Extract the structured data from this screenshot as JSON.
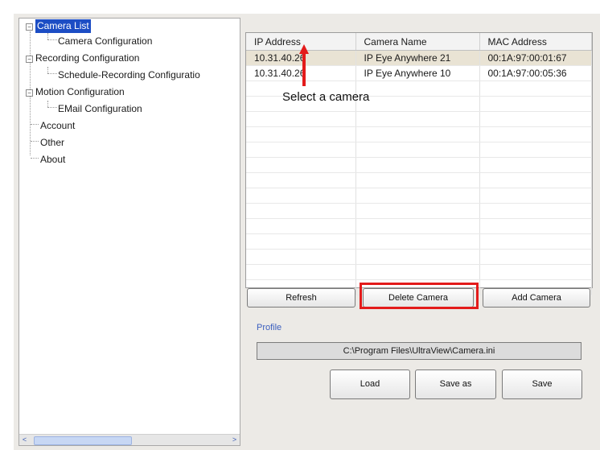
{
  "tree": {
    "items": [
      {
        "label": "Camera List",
        "selected": true
      },
      {
        "label": "Camera Configuration"
      },
      {
        "label": "Recording Configuration"
      },
      {
        "label": "Schedule-Recording Configuratio"
      },
      {
        "label": "Motion Configuration"
      },
      {
        "label": "EMail Configuration"
      },
      {
        "label": "Account"
      },
      {
        "label": "Other"
      },
      {
        "label": "About"
      }
    ],
    "expander_symbol": "−",
    "scroll_left": "<",
    "scroll_right": ">"
  },
  "camera_table": {
    "columns": [
      "IP Address",
      "Camera Name",
      "MAC Address"
    ],
    "rows": [
      [
        "10.31.40.26",
        "IP Eye Anywhere 21",
        "00:1A:97:00:01:67"
      ],
      [
        "10.31.40.26",
        "IP Eye Anywhere 10",
        "00:1A:97:00:05:36"
      ]
    ]
  },
  "buttons": {
    "refresh": "Refresh",
    "delete": "Delete Camera",
    "add": "Add Camera",
    "load": "Load",
    "save_as": "Save as",
    "save": "Save"
  },
  "profile": {
    "label": "Profile",
    "path": "C:\\Program Files\\UltraView\\Camera.ini"
  },
  "annotation": {
    "text": "Select a camera",
    "highlight_color": "#e31b1b"
  }
}
